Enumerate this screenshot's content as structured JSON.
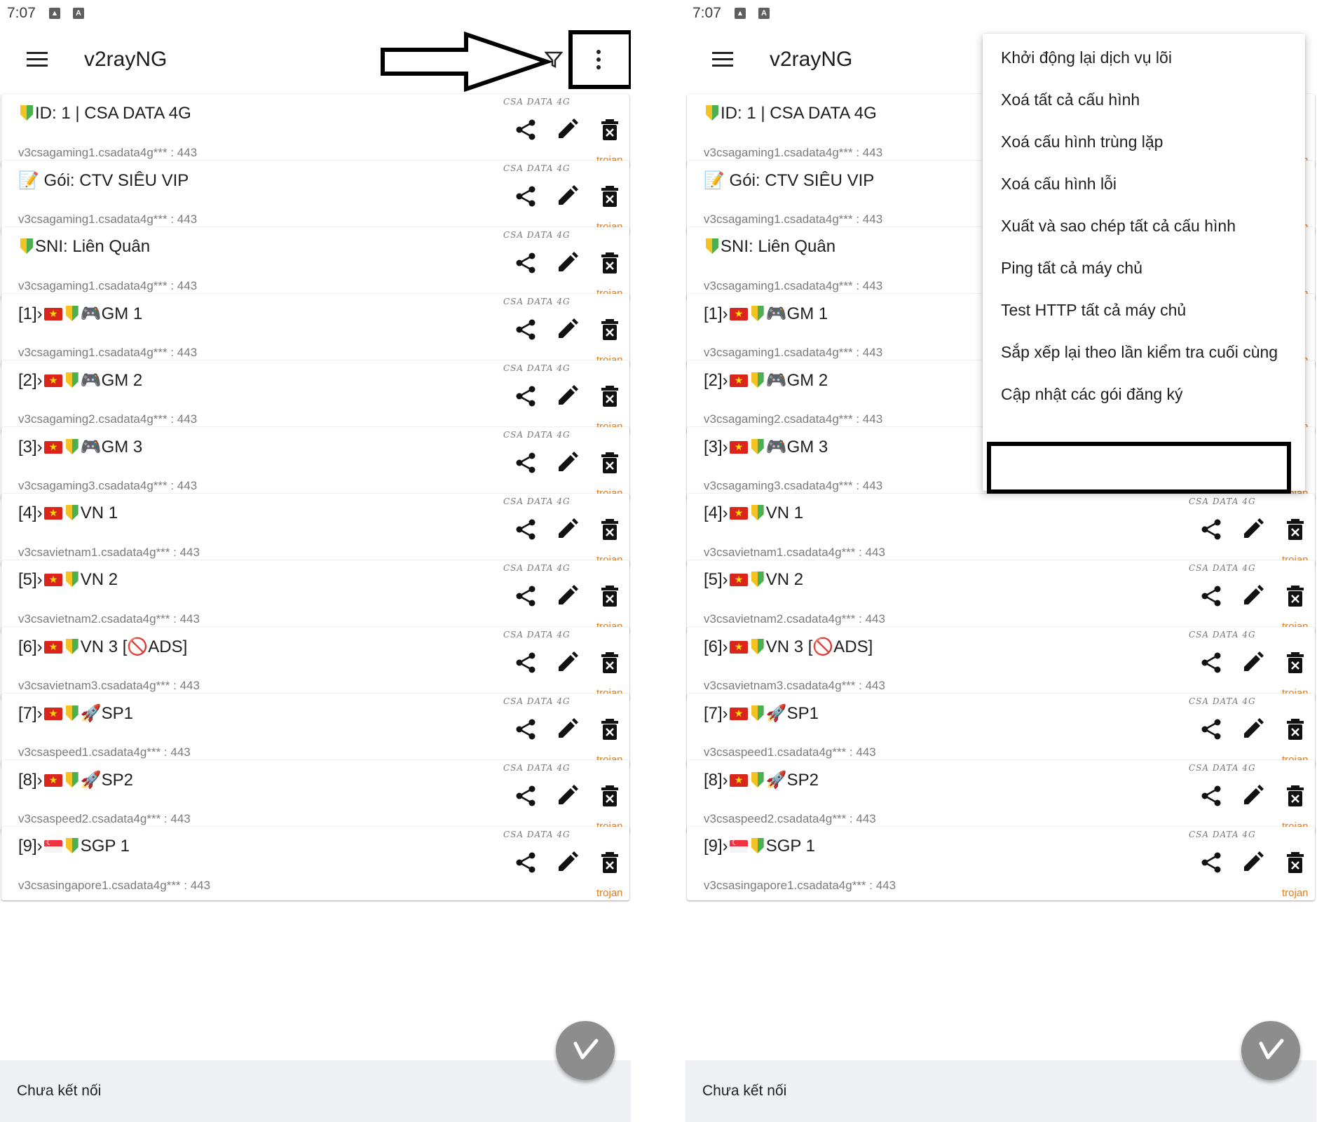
{
  "status_bar": {
    "time": "7:07"
  },
  "app": {
    "title": "v2rayNG"
  },
  "profiles": [
    {
      "parts": [
        [
          "shield"
        ],
        [
          "text",
          "ID: 1 | CSA DATA 4G"
        ]
      ],
      "address": "v3csagaming1.csadata4g*** : 443",
      "type": "trojan",
      "watermark": "CSA DATA 4G"
    },
    {
      "parts": [
        [
          "text",
          "📝 Gói: CTV SIÊU VIP"
        ]
      ],
      "address": "v3csagaming1.csadata4g*** : 443",
      "type": "trojan",
      "watermark": "CSA DATA 4G"
    },
    {
      "parts": [
        [
          "shield"
        ],
        [
          "text",
          "SNI: Liên Quân"
        ]
      ],
      "address": "v3csagaming1.csadata4g*** : 443",
      "type": "trojan",
      "watermark": "CSA DATA 4G"
    },
    {
      "parts": [
        [
          "text",
          "[1]›"
        ],
        [
          "flag-vn"
        ],
        [
          "shield"
        ],
        [
          "text",
          "🎮GM 1"
        ]
      ],
      "address": "v3csagaming1.csadata4g*** : 443",
      "type": "trojan",
      "watermark": "CSA DATA 4G"
    },
    {
      "parts": [
        [
          "text",
          "[2]›"
        ],
        [
          "flag-vn"
        ],
        [
          "shield"
        ],
        [
          "text",
          "🎮GM 2"
        ]
      ],
      "address": "v3csagaming2.csadata4g*** : 443",
      "type": "trojan",
      "watermark": "CSA DATA 4G"
    },
    {
      "parts": [
        [
          "text",
          "[3]›"
        ],
        [
          "flag-vn"
        ],
        [
          "shield"
        ],
        [
          "text",
          "🎮GM 3"
        ]
      ],
      "address": "v3csagaming3.csadata4g*** : 443",
      "type": "trojan",
      "watermark": "CSA DATA 4G"
    },
    {
      "parts": [
        [
          "text",
          "[4]›"
        ],
        [
          "flag-vn"
        ],
        [
          "shield"
        ],
        [
          "text",
          "VN 1"
        ]
      ],
      "address": "v3csavietnam1.csadata4g*** : 443",
      "type": "trojan",
      "watermark": "CSA DATA 4G"
    },
    {
      "parts": [
        [
          "text",
          "[5]›"
        ],
        [
          "flag-vn"
        ],
        [
          "shield"
        ],
        [
          "text",
          "VN 2"
        ]
      ],
      "address": "v3csavietnam2.csadata4g*** : 443",
      "type": "trojan",
      "watermark": "CSA DATA 4G"
    },
    {
      "parts": [
        [
          "text",
          "[6]›"
        ],
        [
          "flag-vn"
        ],
        [
          "shield"
        ],
        [
          "text",
          "VN 3 [🚫ADS]"
        ]
      ],
      "address": "v3csavietnam3.csadata4g*** : 443",
      "type": "trojan",
      "watermark": "CSA DATA 4G"
    },
    {
      "parts": [
        [
          "text",
          "[7]›"
        ],
        [
          "flag-vn"
        ],
        [
          "shield"
        ],
        [
          "text",
          "🚀SP1"
        ]
      ],
      "address": "v3csaspeed1.csadata4g*** : 443",
      "type": "trojan",
      "watermark": "CSA DATA 4G"
    },
    {
      "parts": [
        [
          "text",
          "[8]›"
        ],
        [
          "flag-vn"
        ],
        [
          "shield"
        ],
        [
          "text",
          "🚀SP2"
        ]
      ],
      "address": "v3csaspeed2.csadata4g*** : 443",
      "type": "trojan",
      "watermark": "CSA DATA 4G"
    },
    {
      "parts": [
        [
          "text",
          "[9]›"
        ],
        [
          "flag-sg"
        ],
        [
          "shield"
        ],
        [
          "text",
          "SGP 1"
        ]
      ],
      "address": "v3csasingapore1.csadata4g*** : 443",
      "type": "trojan",
      "watermark": "CSA DATA 4G"
    }
  ],
  "bottom": {
    "status_text": "Chưa kết nối"
  },
  "overflow_menu": {
    "items": [
      "Khởi động lại dịch vụ lõi",
      "Xoá tất cả cấu hình",
      "Xoá cấu hình trùng lặp",
      "Xoá cấu hình lỗi",
      "Xuất và sao chép tất cả cấu hình",
      "Ping tất cả máy chủ",
      "Test HTTP tất cả máy chủ",
      "Sắp xếp lại theo lần kiểm tra cuối cùng",
      "Cập nhật các gói đăng ký"
    ]
  },
  "colors": {
    "protocol_label": "#e07d20",
    "fab": "#8d8d8d",
    "bottom_bar": "#eef0f4",
    "highlight_border": "#000000"
  },
  "icons": [
    "menu-icon",
    "filter-icon",
    "more-vert-icon",
    "share-icon",
    "edit-icon",
    "delete-icon",
    "connect-icon",
    "arrow-annotation"
  ]
}
